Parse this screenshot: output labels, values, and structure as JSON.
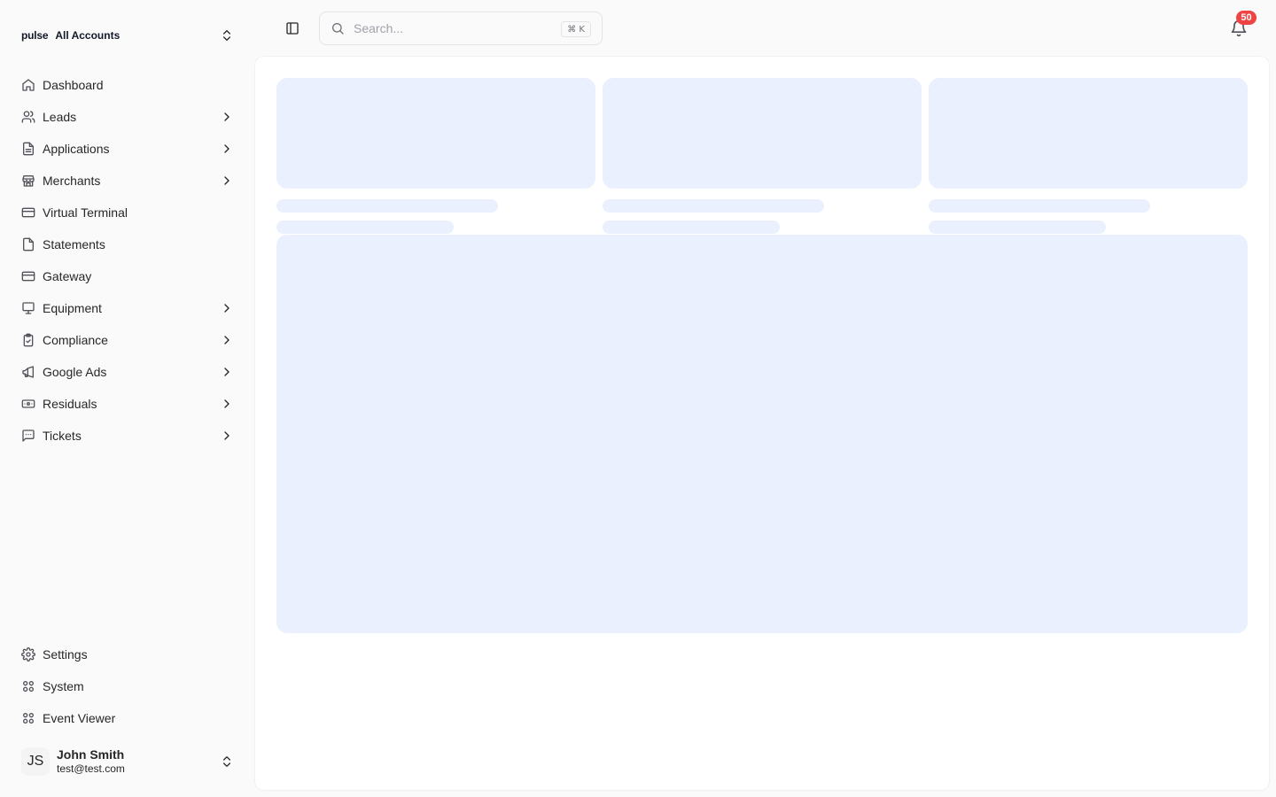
{
  "sidebar": {
    "account_switcher": {
      "logo": "pulse",
      "label": "All Accounts"
    },
    "nav_items": [
      {
        "label": "Dashboard",
        "icon": "home-icon",
        "has_children": false
      },
      {
        "label": "Leads",
        "icon": "users-icon",
        "has_children": true
      },
      {
        "label": "Applications",
        "icon": "file-text-icon",
        "has_children": true
      },
      {
        "label": "Merchants",
        "icon": "store-icon",
        "has_children": true
      },
      {
        "label": "Virtual Terminal",
        "icon": "credit-card-icon",
        "has_children": false
      },
      {
        "label": "Statements",
        "icon": "file-icon",
        "has_children": false
      },
      {
        "label": "Gateway",
        "icon": "credit-card-icon",
        "has_children": false
      },
      {
        "label": "Equipment",
        "icon": "monitor-icon",
        "has_children": true
      },
      {
        "label": "Compliance",
        "icon": "clipboard-check-icon",
        "has_children": true
      },
      {
        "label": "Google Ads",
        "icon": "megaphone-icon",
        "has_children": true
      },
      {
        "label": "Residuals",
        "icon": "banknote-icon",
        "has_children": true
      },
      {
        "label": "Tickets",
        "icon": "message-square-icon",
        "has_children": true
      }
    ],
    "bottom_items": [
      {
        "label": "Settings",
        "icon": "gear-icon"
      },
      {
        "label": "System",
        "icon": "grid-icon"
      },
      {
        "label": "Event Viewer",
        "icon": "grid-icon"
      }
    ],
    "user": {
      "initials": "JS",
      "name": "John Smith",
      "email": "test@test.com"
    }
  },
  "header": {
    "search": {
      "placeholder": "Search...",
      "shortcut": "⌘ K"
    },
    "notifications": {
      "count": "50"
    }
  },
  "colors": {
    "skeleton": "#eaf0fd",
    "badge": "#ef4444",
    "background": "#fafafa"
  }
}
